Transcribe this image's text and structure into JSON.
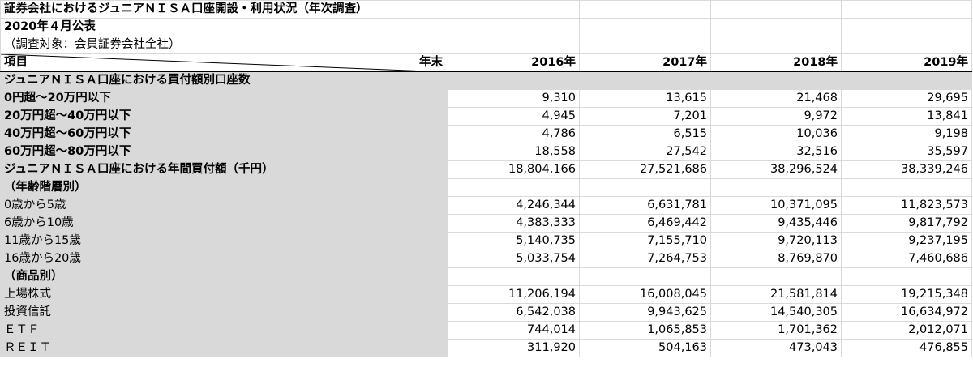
{
  "title": "証券会社におけるジュニアＮＩＳＡ口座開設・利用状況（年次調査）",
  "published": "2020年４月公表",
  "scope": "（調査対象：会員証券会社全社）",
  "header": {
    "item_label": "項目",
    "period_label": "年末",
    "years": [
      "2016年",
      "2017年",
      "2018年",
      "2019年"
    ]
  },
  "sections": {
    "accounts_by_amount": {
      "title": "ジュニアＮＩＳＡ口座における買付額別口座数",
      "rows": [
        {
          "label": "0円超～20万円以下",
          "values": [
            "9,310",
            "13,615",
            "21,468",
            "29,695"
          ]
        },
        {
          "label": "20万円超～40万円以下",
          "values": [
            "4,945",
            "7,201",
            "9,972",
            "13,841"
          ]
        },
        {
          "label": "40万円超～60万円以下",
          "values": [
            "4,786",
            "6,515",
            "10,036",
            "9,198"
          ]
        },
        {
          "label": "60万円超～80万円以下",
          "values": [
            "18,558",
            "27,542",
            "32,516",
            "35,597"
          ]
        }
      ]
    },
    "annual_purchase": {
      "title": "ジュニアＮＩＳＡ口座における年間買付額（千円）",
      "values": [
        "18,804,166",
        "27,521,686",
        "38,296,524",
        "38,339,246"
      ],
      "by_age_title": "（年齢階層別）",
      "by_age": [
        {
          "label": "0歳から5歳",
          "values": [
            "4,246,344",
            "6,631,781",
            "10,371,095",
            "11,823,573"
          ]
        },
        {
          "label": "6歳から10歳",
          "values": [
            "4,383,333",
            "6,469,442",
            "9,435,446",
            "9,817,792"
          ]
        },
        {
          "label": "11歳から15歳",
          "values": [
            "5,140,735",
            "7,155,710",
            "9,720,113",
            "9,237,195"
          ]
        },
        {
          "label": "16歳から20歳",
          "values": [
            "5,033,754",
            "7,264,753",
            "8,769,870",
            "7,460,686"
          ]
        }
      ],
      "by_product_title": "（商品別）",
      "by_product": [
        {
          "label": "上場株式",
          "values": [
            "11,206,194",
            "16,008,045",
            "21,581,814",
            "19,215,348"
          ]
        },
        {
          "label": "投資信託",
          "values": [
            "6,542,038",
            "9,943,625",
            "14,540,305",
            "16,634,972"
          ]
        },
        {
          "label": "ＥＴＦ",
          "values": [
            "744,014",
            "1,065,853",
            "1,701,362",
            "2,012,071"
          ]
        },
        {
          "label": "ＲＥＩＴ",
          "values": [
            "311,920",
            "504,163",
            "473,043",
            "476,855"
          ]
        }
      ]
    }
  }
}
